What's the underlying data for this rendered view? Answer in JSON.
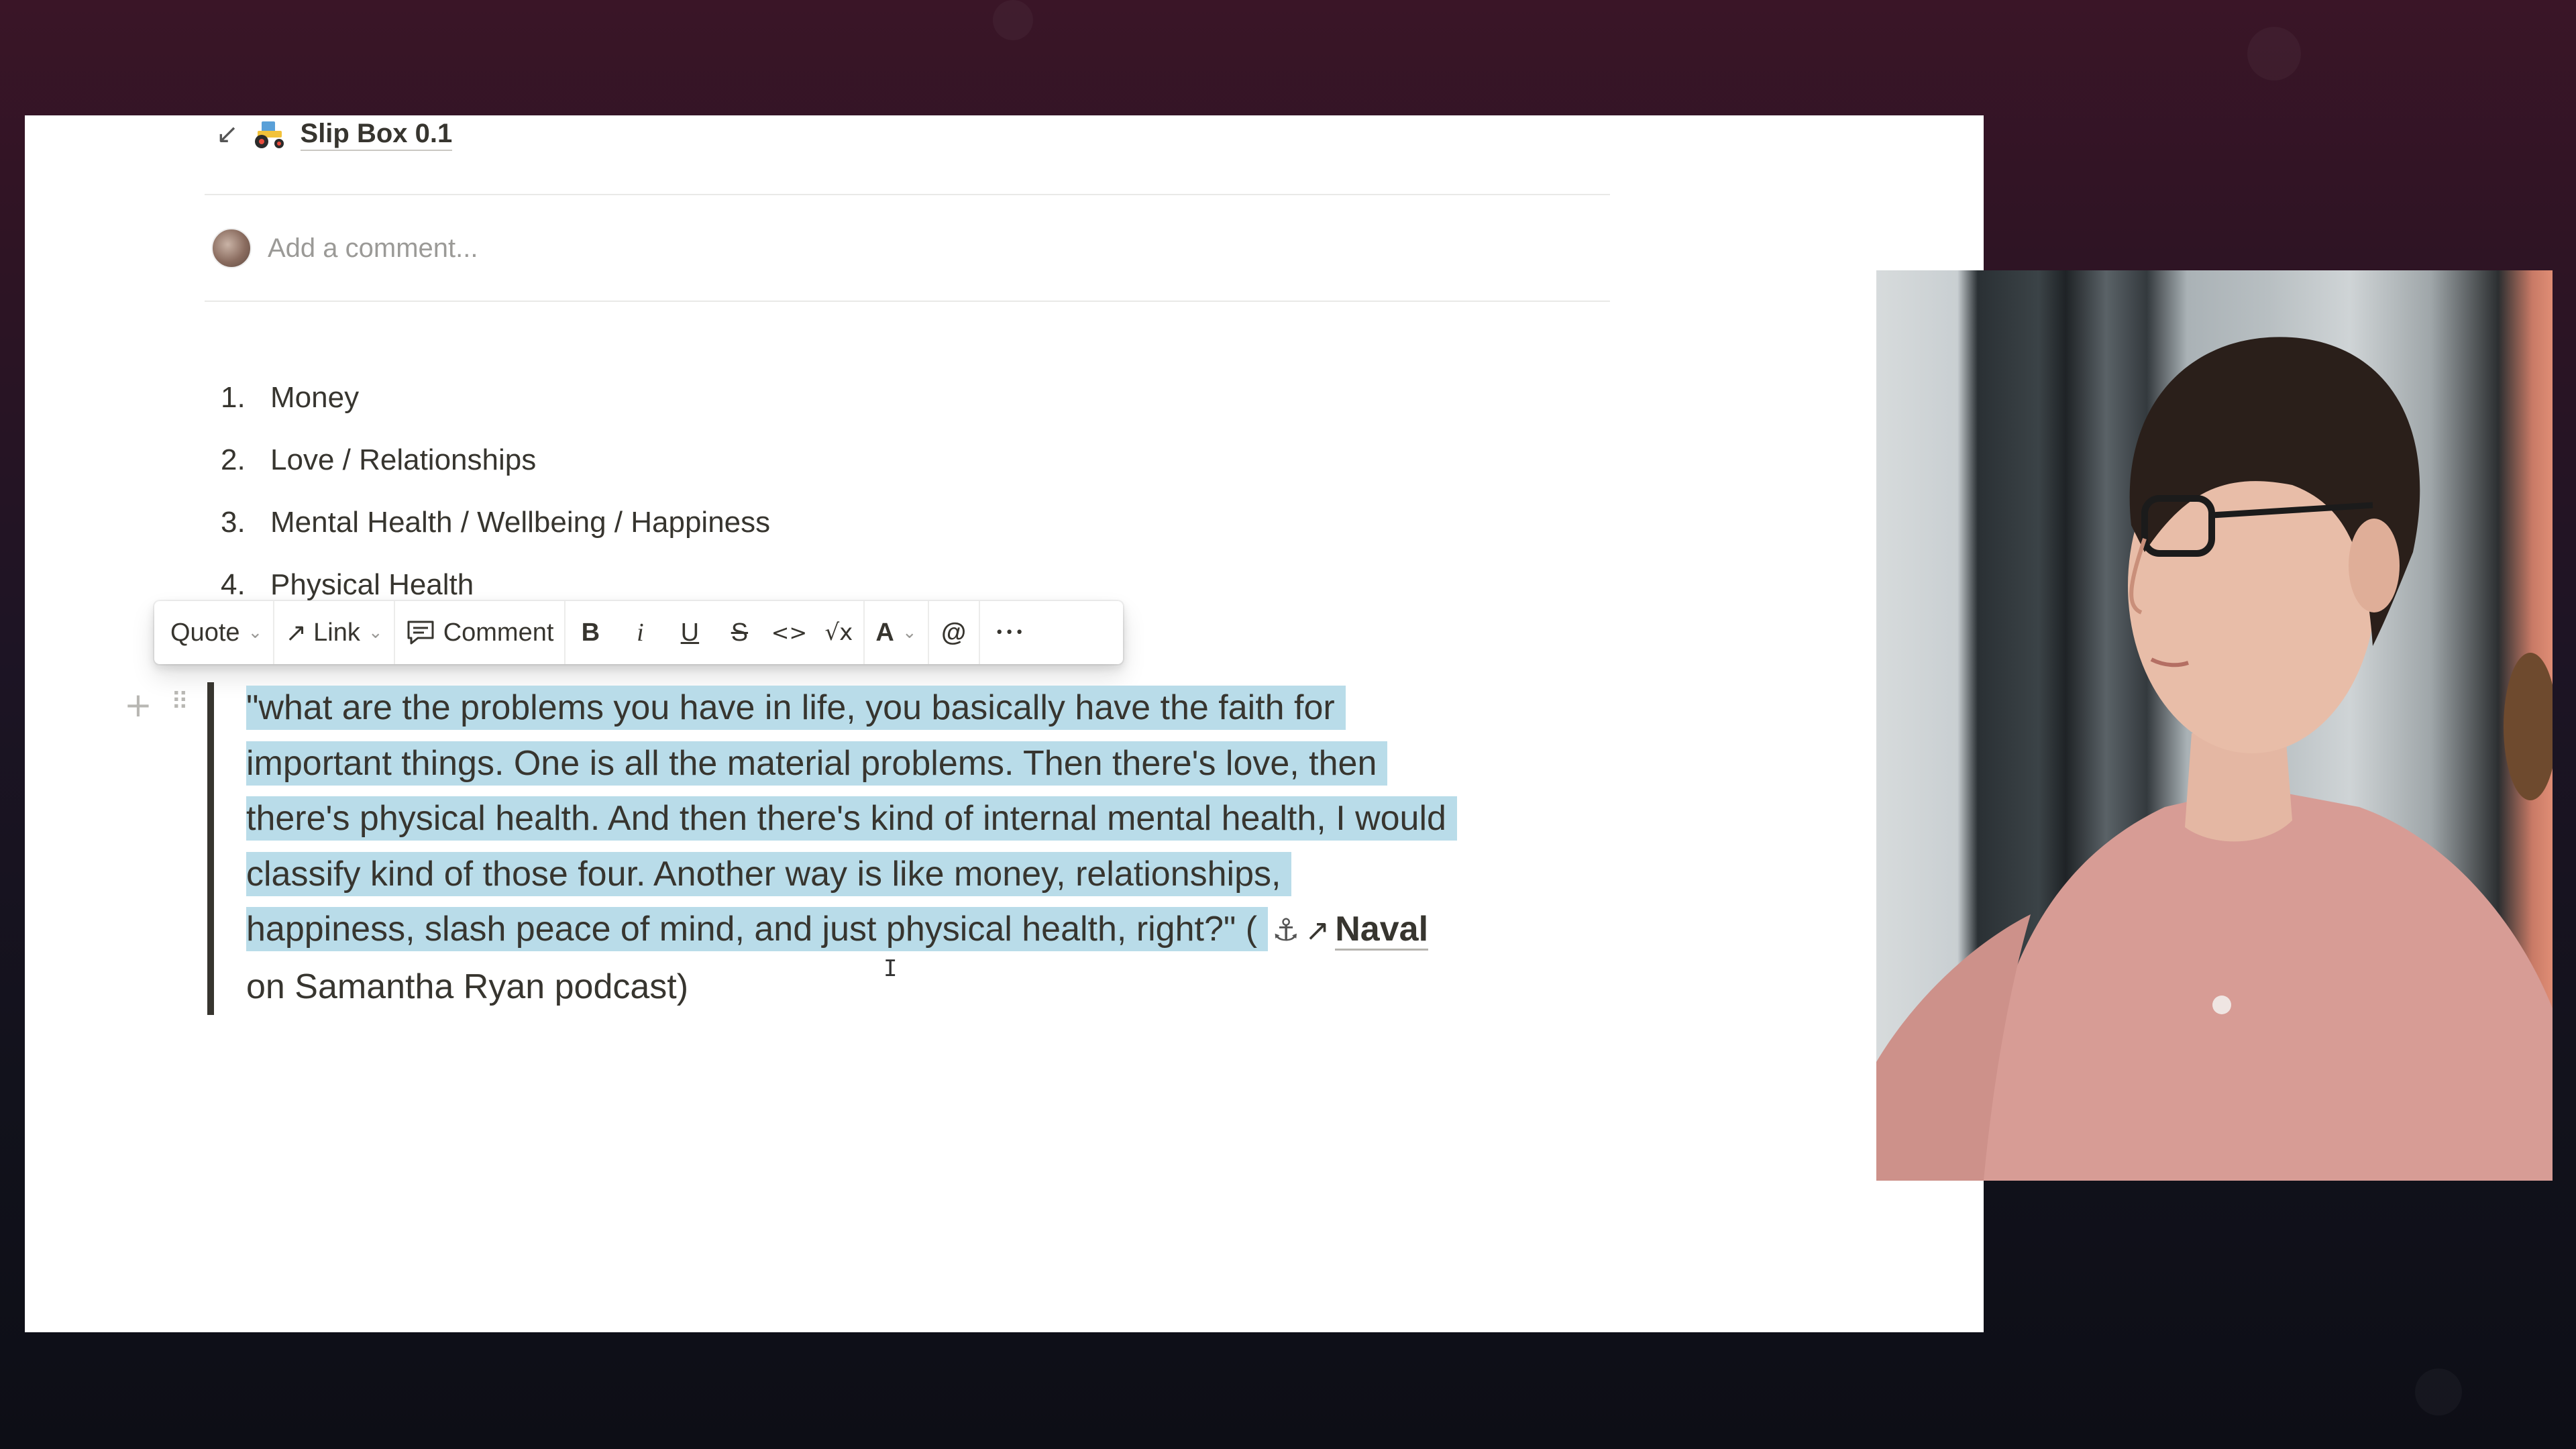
{
  "backlink": {
    "arrow": "↙",
    "title": "Slip Box 0.1"
  },
  "comment": {
    "placeholder": "Add a comment..."
  },
  "list": [
    {
      "num": "1.",
      "text": "Money"
    },
    {
      "num": "2.",
      "text": "Love / Relationships"
    },
    {
      "num": "3.",
      "text": "Mental Health / Wellbeing / Happiness"
    },
    {
      "num": "4.",
      "text": "Physical Health"
    }
  ],
  "toolbar": {
    "block_type": "Quote",
    "link": "Link",
    "comment": "Comment",
    "bold": "B",
    "italic": "i",
    "underline": "U",
    "strike": "S",
    "code": "<>",
    "equation": "√x",
    "color": "A",
    "mention": "@",
    "more": "•••"
  },
  "quote": {
    "lines": [
      "\"what are the problems you have in life, you basically have the faith for",
      "important things. One is all the material problems. Then there's love, then",
      "there's physical health. And then there's kind of internal mental health, I would",
      "classify kind of those four. Another way is like money, relationships,",
      "happiness, slash peace of mind, and just physical health, right?\" ("
    ],
    "anchor": "⚓",
    "link_arrow": "↗",
    "link_text": "Naval",
    "tail": "on Samantha Ryan podcast)"
  },
  "cursor": "I"
}
